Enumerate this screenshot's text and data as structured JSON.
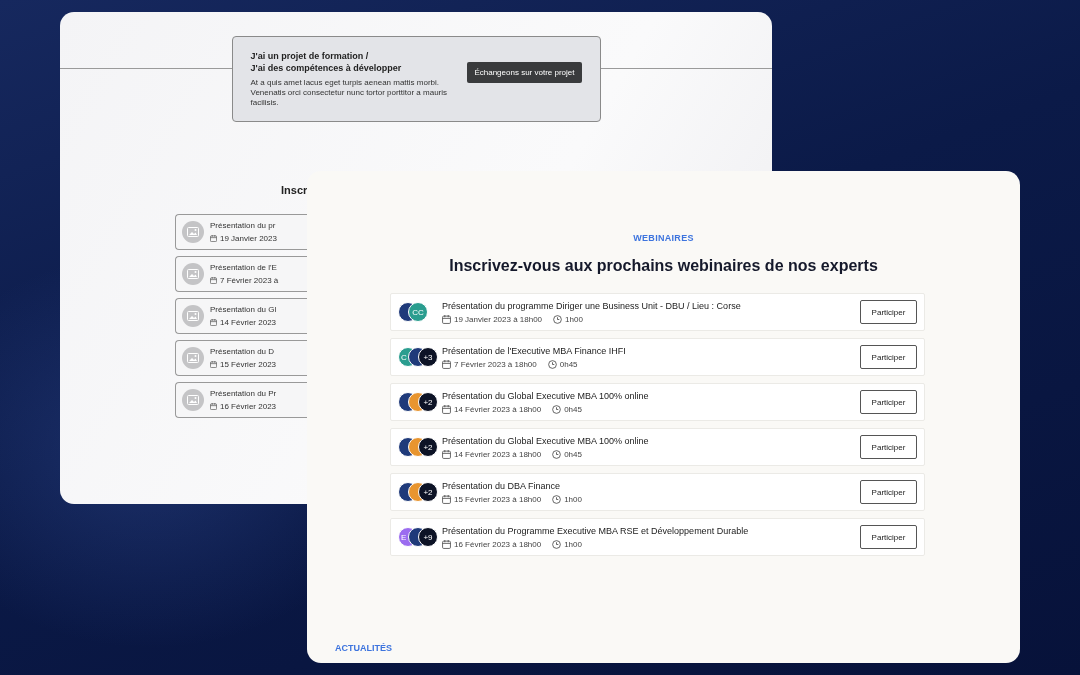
{
  "back_window": {
    "banner": {
      "title_lines": [
        "J'ai un projet de formation /",
        "J'ai des compétences à développer"
      ],
      "text": "At a quis amet lacus eget turpis aenean mattis morbi. Venenatis orci consectetur nunc tortor porttitor a mauris facilisis.",
      "button": "Échangeons sur votre projet"
    },
    "heading": "Inscr",
    "items": [
      {
        "title": "Présentation du pr",
        "date": "19 Janvier 2023"
      },
      {
        "title": "Présentation de l'E",
        "date": "7 Février 2023 à"
      },
      {
        "title": "Présentation du Gl",
        "date": "14 Février 2023"
      },
      {
        "title": "Présentation du D",
        "date": "15 Février 2023"
      },
      {
        "title": "Présentation du Pr",
        "date": "16 Février 2023"
      }
    ]
  },
  "front_window": {
    "eyebrow": "WEBINAIRES",
    "heading": "Inscrivez-vous aux prochains webinaires de nos experts",
    "webinars": [
      {
        "avatars": [
          {
            "color": "#1f3a7a"
          },
          {
            "color": "#2a9d8f",
            "label": "CC"
          }
        ],
        "title": "Présentation du programme Diriger une Business Unit - DBU / Lieu : Corse",
        "date": "19 Janvier 2023 à 18h00",
        "duration": "1h00",
        "button": "Participer"
      },
      {
        "avatars": [
          {
            "color": "#2a9d8f",
            "label": "C"
          },
          {
            "color": "#1f3a7a"
          },
          {
            "color": "#0d1326",
            "label": "+3"
          }
        ],
        "title": "Présentation de l'Executive MBA Finance IHFI",
        "date": "7 Février 2023 à 18h00",
        "duration": "0h45",
        "button": "Participer"
      },
      {
        "avatars": [
          {
            "color": "#1f3a7a"
          },
          {
            "color": "#e8952f"
          },
          {
            "color": "#0d1326",
            "label": "+2"
          }
        ],
        "title": "Présentation du Global Executive MBA 100% online",
        "date": "14 Février 2023 à 18h00",
        "duration": "0h45",
        "button": "Participer"
      },
      {
        "avatars": [
          {
            "color": "#1f3a7a"
          },
          {
            "color": "#e8952f"
          },
          {
            "color": "#0d1326",
            "label": "+2"
          }
        ],
        "title": "Présentation du Global Executive MBA 100% online",
        "date": "14 Février 2023 à 18h00",
        "duration": "0h45",
        "button": "Participer"
      },
      {
        "avatars": [
          {
            "color": "#1f3a7a"
          },
          {
            "color": "#e8952f"
          },
          {
            "color": "#0d1326",
            "label": "+2"
          }
        ],
        "title": "Présentation du DBA Finance",
        "date": "15 Février 2023 à 18h00",
        "duration": "1h00",
        "button": "Participer"
      },
      {
        "avatars": [
          {
            "color": "#9b6cf0",
            "label": "E"
          },
          {
            "color": "#1f3a7a"
          },
          {
            "color": "#0d1326",
            "label": "+9"
          }
        ],
        "title": "Présentation du Programme Executive MBA RSE et Développement Durable",
        "date": "16 Février 2023 à 18h00",
        "duration": "1h00",
        "button": "Participer"
      }
    ],
    "footer_section": "ACTUALITÉS"
  }
}
